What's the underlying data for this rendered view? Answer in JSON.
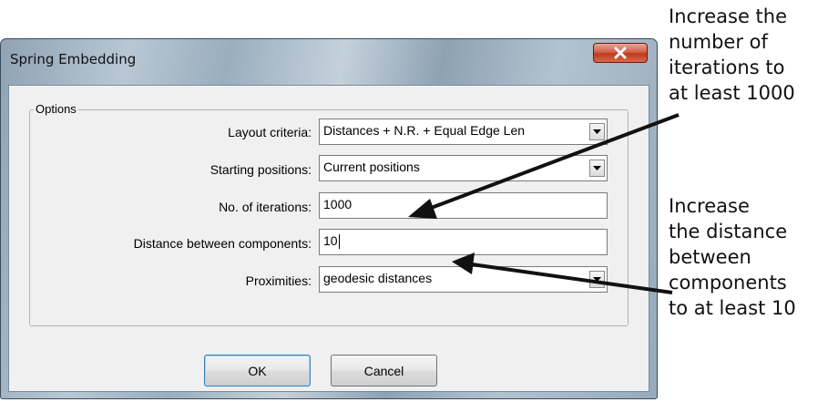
{
  "window": {
    "title": "Spring Embedding",
    "close_icon": "close-x-icon"
  },
  "options": {
    "group_label": "Options",
    "layout_criteria": {
      "label": "Layout criteria:",
      "value": "Distances + N.R. + Equal Edge Len"
    },
    "starting_positions": {
      "label": "Starting positions:",
      "value": "Current positions"
    },
    "iterations": {
      "label": "No. of iterations:",
      "value": "1000"
    },
    "distance_components": {
      "label": "Distance between components:",
      "value": "10"
    },
    "proximities": {
      "label": "Proximities:",
      "value": "geodesic distances"
    }
  },
  "buttons": {
    "ok": "OK",
    "cancel": "Cancel"
  },
  "annotations": {
    "iterations_note": "Increase the\nnumber of\niterations to\nat least 1000",
    "distance_note": "Increase\nthe distance\nbetween\ncomponents\nto at least 10"
  },
  "colors": {
    "close_button": "#c0391e",
    "client_bg": "#f0f0f0",
    "arrow": "#111111"
  }
}
